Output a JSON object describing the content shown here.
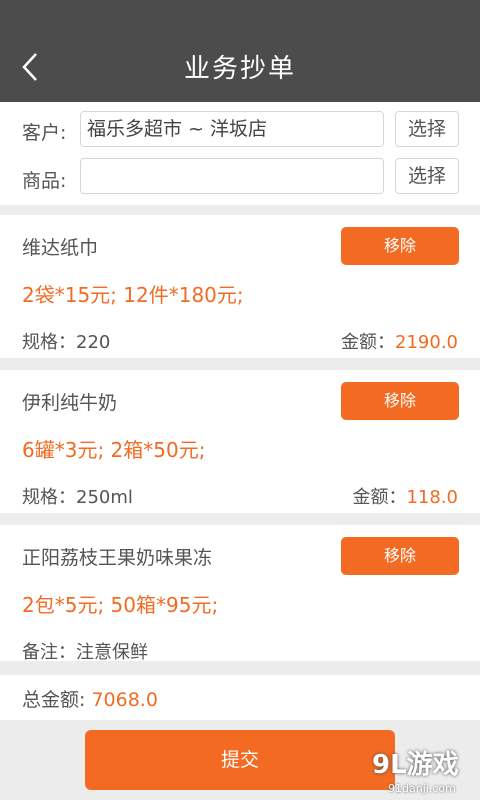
{
  "header": {
    "title": "业务抄单",
    "back_icon": "chevron-left-icon"
  },
  "form": {
    "customer_label": "客户:",
    "customer_value": "福乐多超市 ~ 洋坂店",
    "product_label": "商品:",
    "product_value": "",
    "select_label": "选择"
  },
  "items": [
    {
      "name": "维达纸巾",
      "remove_label": "移除",
      "price": "2袋*15元; 12件*180元;",
      "spec_label": "规格：",
      "spec": "220",
      "amount_label": "金额：",
      "amount": "2190.0"
    },
    {
      "name": "伊利纯牛奶",
      "remove_label": "移除",
      "price": "6罐*3元; 2箱*50元;",
      "spec_label": "规格：",
      "spec": "250ml",
      "amount_label": "金额：",
      "amount": "118.0"
    },
    {
      "name": "正阳荔枝王果奶味果冻",
      "remove_label": "移除",
      "price": "2包*5元; 50箱*95元;",
      "note_label": "备注：",
      "note": "注意保鲜"
    }
  ],
  "summary": {
    "total_label": "总金额: ",
    "total_value": "7068.0"
  },
  "footer": {
    "submit_label": "提交"
  },
  "watermark": {
    "logo": "9L游戏",
    "site": "91danji.com"
  },
  "colors": {
    "accent": "#f36b22",
    "header_bg": "#4c4c4c",
    "background": "#ececec"
  }
}
